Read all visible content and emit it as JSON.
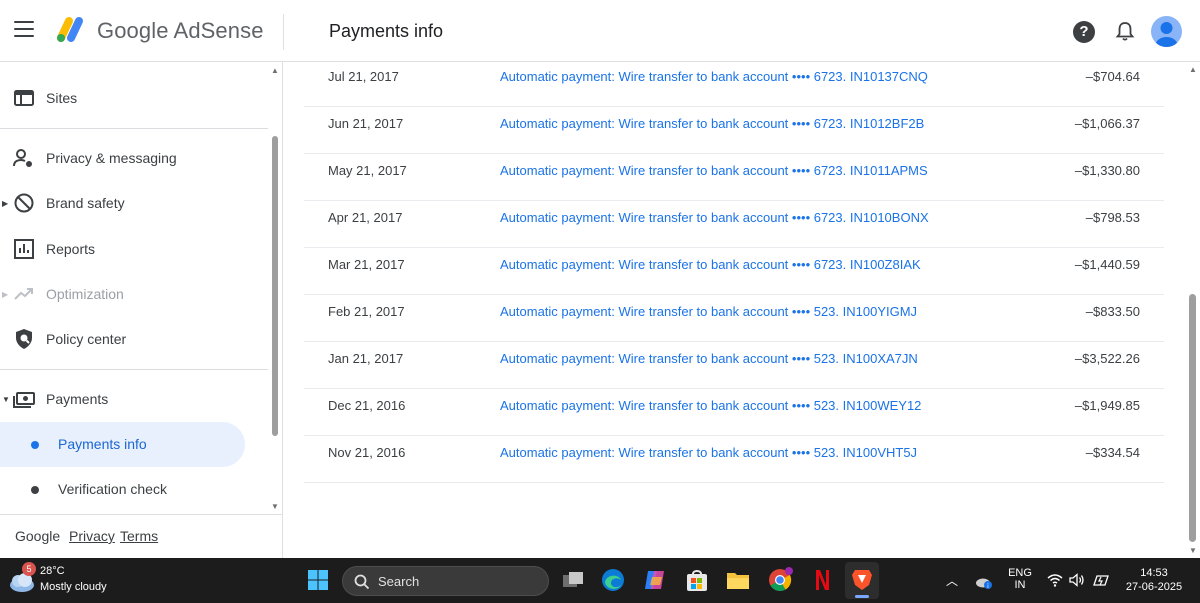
{
  "header": {
    "brand": "Google AdSense",
    "page_title": "Payments info"
  },
  "sidebar": {
    "items": [
      {
        "label": "Sites"
      },
      {
        "label": "Privacy & messaging"
      },
      {
        "label": "Brand safety"
      },
      {
        "label": "Reports"
      },
      {
        "label": "Optimization"
      },
      {
        "label": "Policy center"
      },
      {
        "label": "Payments"
      }
    ],
    "sub_items": [
      {
        "label": "Payments info",
        "active": true
      },
      {
        "label": "Verification check",
        "active": false
      }
    ],
    "footer": {
      "google": "Google",
      "privacy": "Privacy",
      "terms": "Terms"
    }
  },
  "transactions": [
    {
      "date": "Jul 21, 2017",
      "description": "Automatic payment: Wire transfer to bank account •••• 6723. IN10137CNQ",
      "amount": "–$704.64"
    },
    {
      "date": "Jun 21, 2017",
      "description": "Automatic payment: Wire transfer to bank account •••• 6723. IN1012BF2B",
      "amount": "–$1,066.37"
    },
    {
      "date": "May 21, 2017",
      "description": "Automatic payment: Wire transfer to bank account •••• 6723. IN1011APMS",
      "amount": "–$1,330.80"
    },
    {
      "date": "Apr 21, 2017",
      "description": "Automatic payment: Wire transfer to bank account •••• 6723. IN1010BONX",
      "amount": "–$798.53"
    },
    {
      "date": "Mar 21, 2017",
      "description": "Automatic payment: Wire transfer to bank account •••• 6723. IN100Z8IAK",
      "amount": "–$1,440.59"
    },
    {
      "date": "Feb 21, 2017",
      "description": "Automatic payment: Wire transfer to bank account •••• 523. IN100YIGMJ",
      "amount": "–$833.50"
    },
    {
      "date": "Jan 21, 2017",
      "description": "Automatic payment: Wire transfer to bank account •••• 523. IN100XA7JN",
      "amount": "–$3,522.26"
    },
    {
      "date": "Dec 21, 2016",
      "description": "Automatic payment: Wire transfer to bank account •••• 523. IN100WEY12",
      "amount": "–$1,949.85"
    },
    {
      "date": "Nov 21, 2016",
      "description": "Automatic payment: Wire transfer to bank account •••• 523. IN100VHT5J",
      "amount": "–$334.54"
    }
  ],
  "taskbar": {
    "weather_temp": "28°C",
    "weather_condition": "Mostly cloudy",
    "weather_badge": "5",
    "search_label": "Search",
    "lang": "ENG",
    "region": "IN",
    "time": "14:53",
    "date": "27-06-2025"
  },
  "colors": {
    "link": "#1a73e8",
    "active_nav_bg": "#e8f0fe",
    "taskbar_bg": "#1c1c1c"
  }
}
